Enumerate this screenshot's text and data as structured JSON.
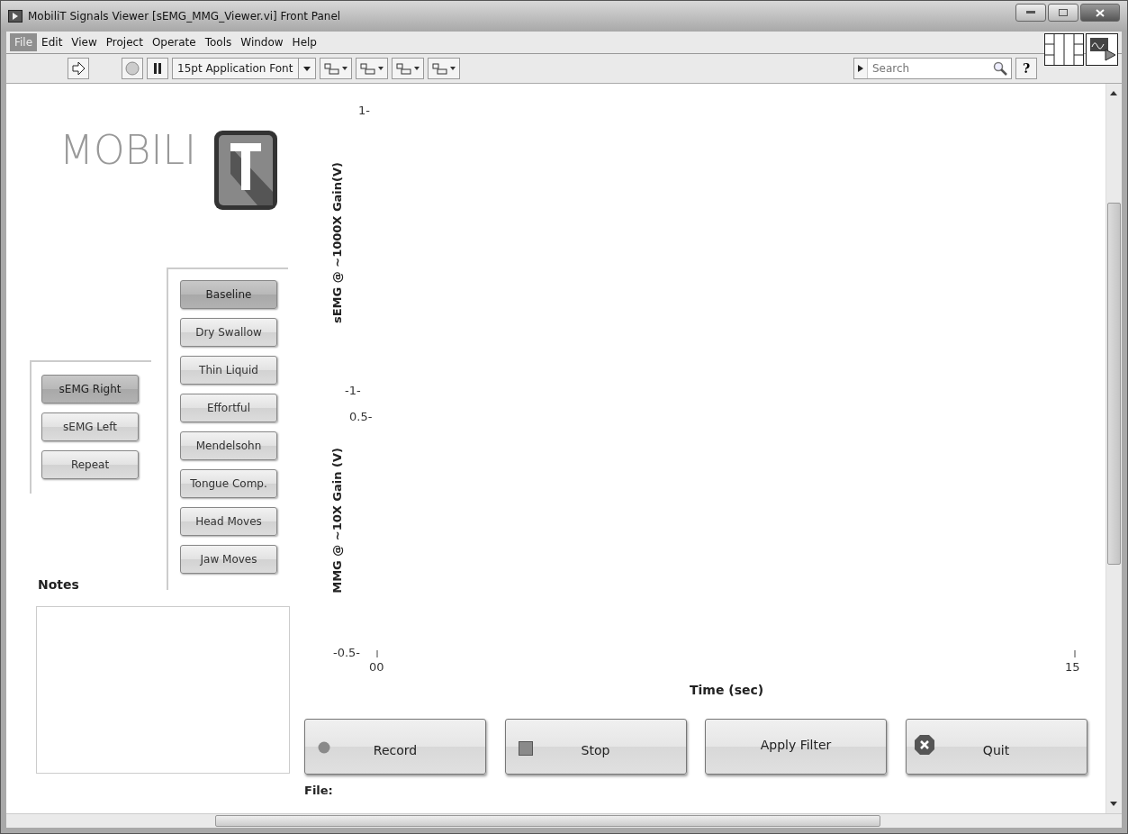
{
  "window": {
    "title": "MobiliT Signals Viewer [sEMG_MMG_Viewer.vi] Front Panel"
  },
  "menu": [
    {
      "label": "File",
      "selected": true
    },
    {
      "label": "Edit",
      "selected": false
    },
    {
      "label": "View",
      "selected": false
    },
    {
      "label": "Project",
      "selected": false
    },
    {
      "label": "Operate",
      "selected": false
    },
    {
      "label": "Tools",
      "selected": false
    },
    {
      "label": "Window",
      "selected": false
    },
    {
      "label": "Help",
      "selected": false
    }
  ],
  "toolbar": {
    "font": "15pt Application Font",
    "search": {
      "placeholder": "Search"
    },
    "help": "?"
  },
  "logo": {
    "text": "MOBILI"
  },
  "channel_buttons": [
    {
      "label": "sEMG Right",
      "selected": true
    },
    {
      "label": "sEMG Left",
      "selected": false
    },
    {
      "label": "Repeat",
      "selected": false
    }
  ],
  "task_buttons": [
    {
      "label": "Baseline",
      "selected": true
    },
    {
      "label": "Dry Swallow",
      "selected": false
    },
    {
      "label": "Thin Liquid",
      "selected": false
    },
    {
      "label": "Effortful",
      "selected": false
    },
    {
      "label": "Mendelsohn",
      "selected": false
    },
    {
      "label": "Tongue Comp.",
      "selected": false
    },
    {
      "label": "Head Moves",
      "selected": false
    },
    {
      "label": "Jaw Moves",
      "selected": false
    }
  ],
  "notes": {
    "label": "Notes"
  },
  "graphs": [
    {
      "ylabel": "sEMG @ ~1000X Gain(V)",
      "ymax": "1-",
      "ymin": "-1-"
    },
    {
      "ylabel": "MMG @ ~10X Gain (V)",
      "ymax": "0.5-",
      "ymin": "-0.5-"
    }
  ],
  "xaxis": {
    "start": "00",
    "end": "15",
    "label": "Time (sec)"
  },
  "actions": [
    {
      "label": "Record",
      "kind": "record"
    },
    {
      "label": "Stop",
      "kind": "stop"
    },
    {
      "label": "Apply Filter",
      "kind": "plain"
    },
    {
      "label": "Quit",
      "kind": "quit"
    }
  ],
  "file": {
    "label": "File:"
  }
}
